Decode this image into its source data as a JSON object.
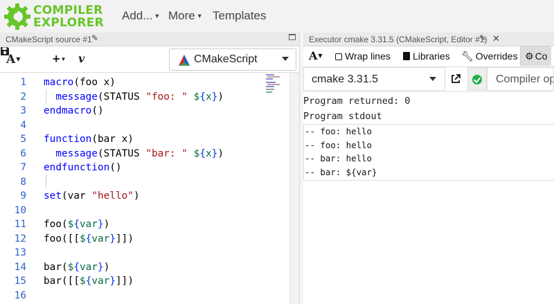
{
  "navbar": {
    "logo_line1": "COMPILER",
    "logo_line2": "EXPLORER",
    "menu": [
      "Add...",
      "More",
      "Templates"
    ],
    "brand_color": "#67c52a"
  },
  "source_pane": {
    "tab_title": "CMakeScript source #1",
    "toolbar": {
      "font_button": "A",
      "add_button": "+",
      "vim_button": "v",
      "language": "CMakeScript"
    },
    "line_numbers": [
      "1",
      "2",
      "3",
      "4",
      "5",
      "6",
      "7",
      "8",
      "9",
      "10",
      "11",
      "12",
      "13",
      "14",
      "15",
      "16"
    ],
    "code_lines": [
      "macro(foo x)",
      "  message(STATUS \"foo: \" ${x})",
      "endmacro()",
      "",
      "function(bar x)",
      "  message(STATUS \"bar: \" ${x})",
      "endfunction()",
      "",
      "set(var \"hello\")",
      "",
      "foo(${var})",
      "foo([[${var}]])",
      "",
      "bar(${var})",
      "bar([[${var}]])",
      ""
    ]
  },
  "executor_pane": {
    "tab_title": "Executor cmake 3.31.5 (CMakeScript, Editor #1)",
    "toolbar": {
      "font_button": "A",
      "wrap_lines": "Wrap lines",
      "libraries": "Libraries",
      "overrides": "Overrides",
      "compiler_tab": "Co"
    },
    "compiler": "cmake 3.31.5",
    "compiler_options_placeholder": "Compiler options",
    "program_returned": "Program returned: 0",
    "stdout_label": "Program stdout",
    "stdout_lines": [
      "-- foo: hello",
      "-- foo: hello",
      "-- bar: hello",
      "-- bar: ${var}"
    ],
    "status_color": "#22b04b"
  }
}
